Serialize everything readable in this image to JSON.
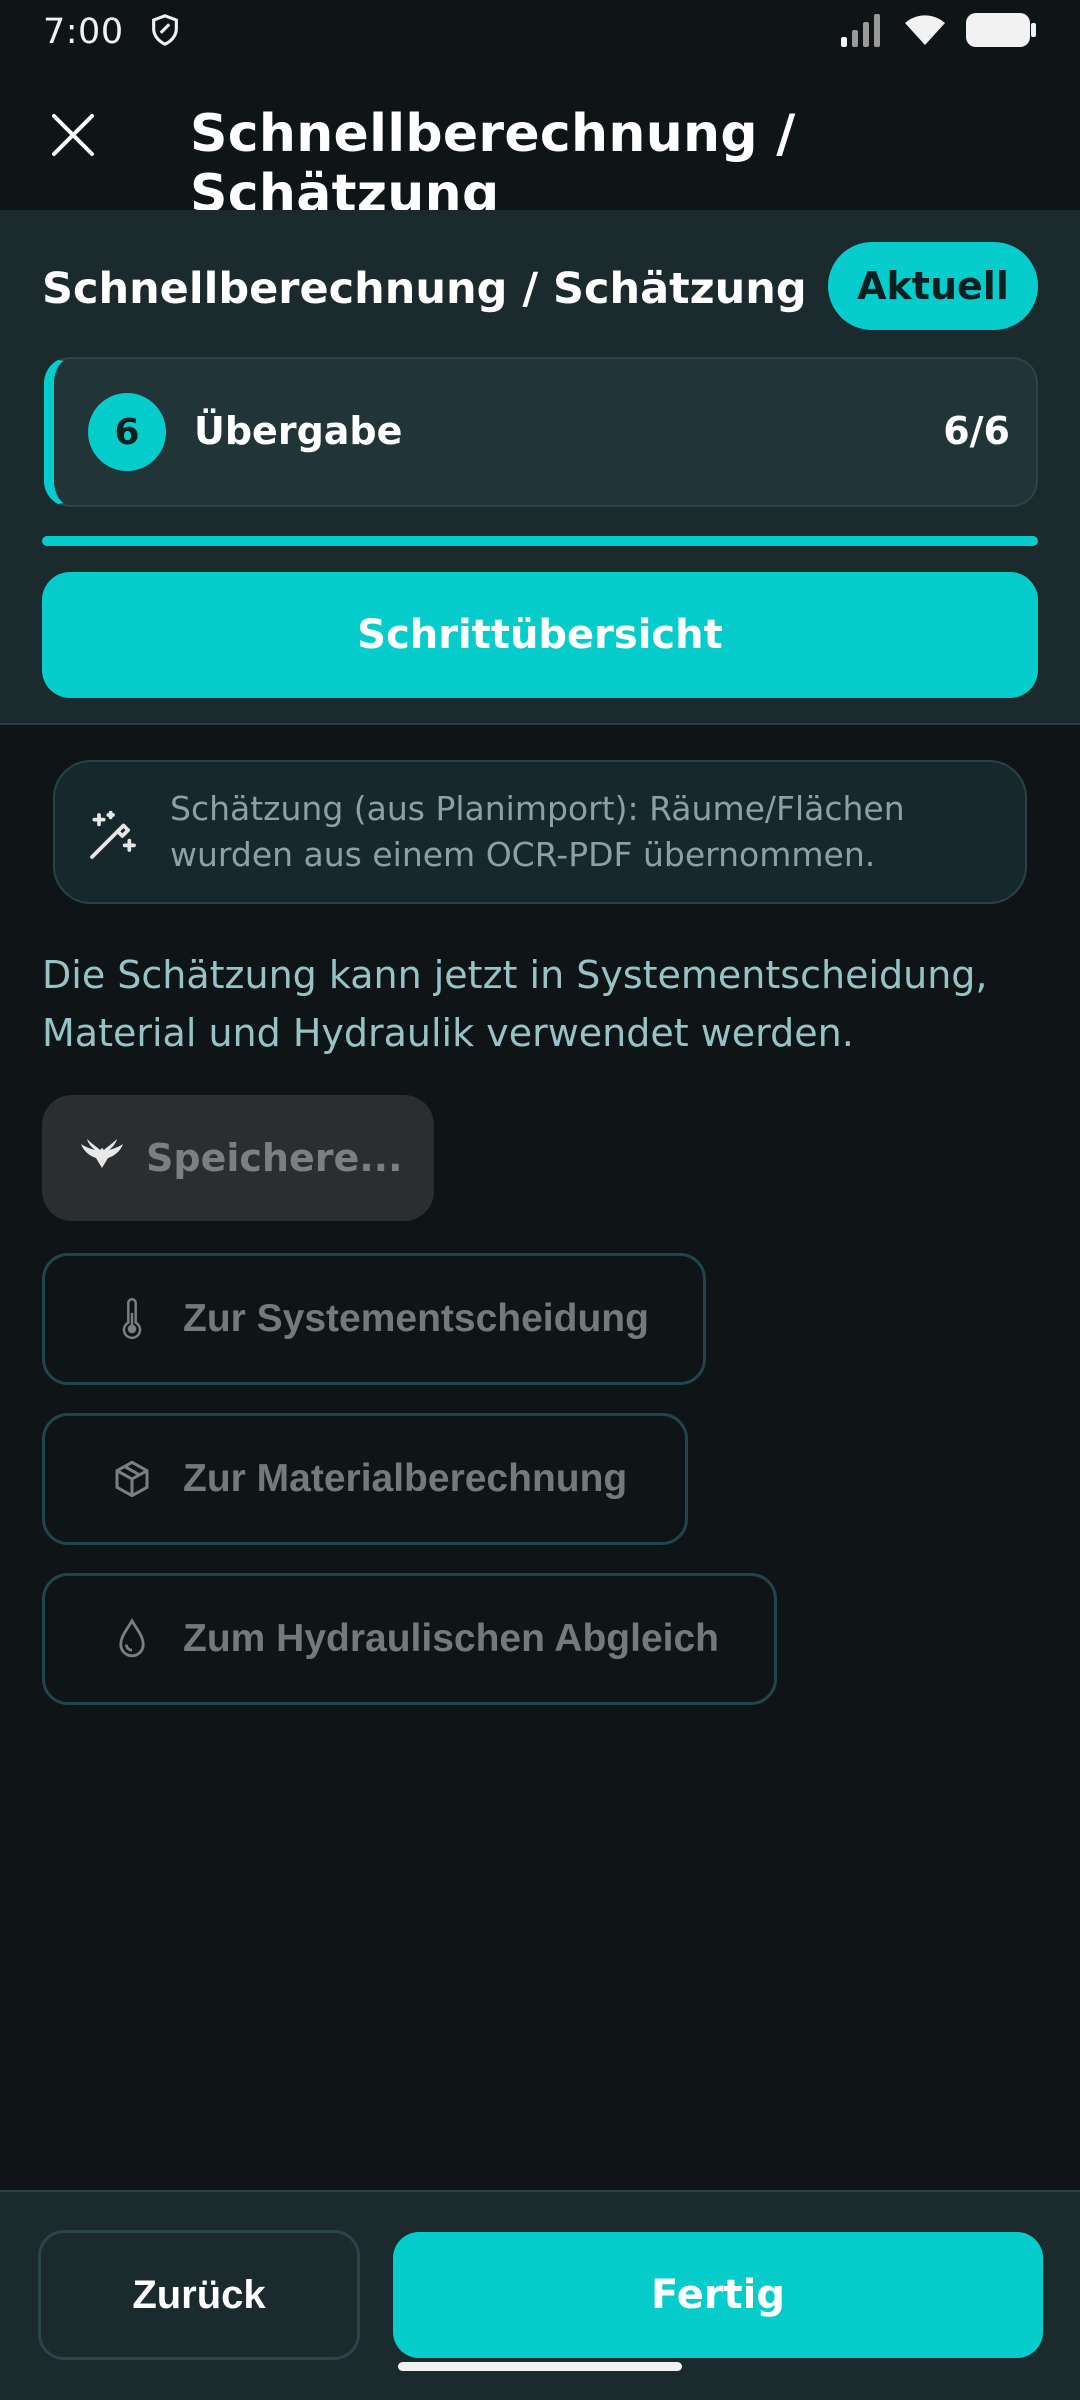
{
  "status_bar": {
    "time": "7:00"
  },
  "app_bar": {
    "title": "Schnellberechnung / Schätzung"
  },
  "header": {
    "title": "Schnellberechnung / Schätzung",
    "badge": "Aktuell",
    "step": {
      "number": "6",
      "label": "Übergabe",
      "count": "6/6"
    },
    "progress_fraction": 1.0,
    "overview_button": "Schrittübersicht"
  },
  "info": {
    "text": "Schätzung (aus Planimport): Räume/Flächen wurden aus einem OCR-PDF übernommen."
  },
  "description": "Die Schätzung kann jetzt in Systementscheidung, Material und Hydraulik verwendet werden.",
  "saving_button": "Speichere...",
  "nav_buttons": [
    {
      "label": "Zur Systementscheidung",
      "icon": "thermometer-icon"
    },
    {
      "label": "Zur Materialberechnung",
      "icon": "package-icon"
    },
    {
      "label": "Zum Hydraulischen Abgleich",
      "icon": "droplet-icon"
    }
  ],
  "footer": {
    "back": "Zurück",
    "finish": "Fertig"
  },
  "colors": {
    "accent": "#06cccc",
    "background": "#0f1517",
    "panel": "#1a2a2d"
  }
}
